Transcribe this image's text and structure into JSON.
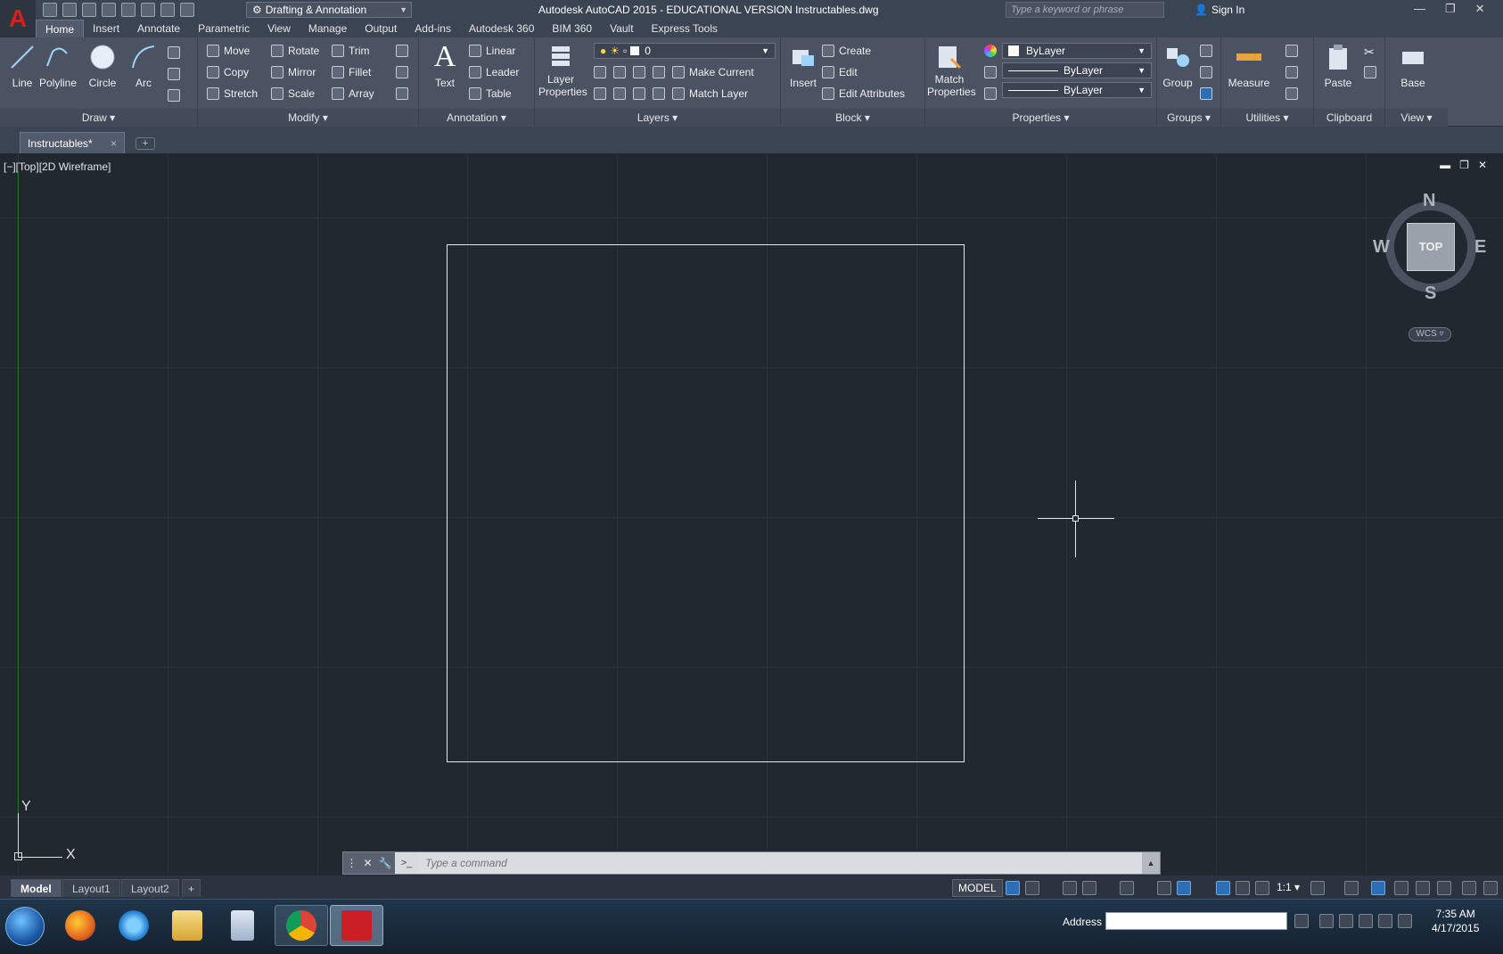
{
  "titlebar": {
    "app_title": "Autodesk AutoCAD 2015 - EDUCATIONAL VERSION    Instructables.dwg",
    "workspace": "Drafting & Annotation",
    "search_placeholder": "Type a keyword or phrase",
    "sign_in": "Sign In"
  },
  "tabs": [
    "Home",
    "Insert",
    "Annotate",
    "Parametric",
    "View",
    "Manage",
    "Output",
    "Add-ins",
    "Autodesk 360",
    "BIM 360",
    "Vault",
    "Express Tools"
  ],
  "ribbon": {
    "draw": {
      "footer": "Draw ▾",
      "line": "Line",
      "polyline": "Polyline",
      "circle": "Circle",
      "arc": "Arc"
    },
    "modify": {
      "footer": "Modify ▾",
      "move": "Move",
      "rotate": "Rotate",
      "trim": "Trim",
      "copy": "Copy",
      "mirror": "Mirror",
      "fillet": "Fillet",
      "stretch": "Stretch",
      "scale": "Scale",
      "array": "Array"
    },
    "annotation": {
      "footer": "Annotation ▾",
      "text": "Text",
      "linear": "Linear",
      "leader": "Leader",
      "table": "Table"
    },
    "layers": {
      "footer": "Layers ▾",
      "layer_properties_1": "Layer",
      "layer_properties_2": "Properties",
      "current_layer": "0",
      "make_current": "Make Current",
      "match_layer": "Match Layer"
    },
    "block": {
      "footer": "Block ▾",
      "insert": "Insert",
      "create": "Create",
      "edit": "Edit",
      "edit_attributes": "Edit Attributes"
    },
    "properties": {
      "footer": "Properties ▾",
      "match_1": "Match",
      "match_2": "Properties",
      "color": "ByLayer",
      "linetype": "ByLayer",
      "lineweight": "ByLayer"
    },
    "groups": {
      "footer": "Groups ▾",
      "group": "Group"
    },
    "utilities": {
      "footer": "Utilities ▾",
      "measure": "Measure"
    },
    "clipboard": {
      "footer": "Clipboard",
      "paste": "Paste"
    },
    "view": {
      "footer": "View ▾",
      "base": "Base"
    }
  },
  "doc_tab": {
    "name": "Instructables*",
    "close": "×",
    "new": "+"
  },
  "viewport": {
    "label": "[−][Top][2D Wireframe]",
    "viewcube_top": "TOP",
    "north": "N",
    "south": "S",
    "east": "E",
    "west": "W",
    "wcs": "WCS ▿",
    "ucs_y": "Y",
    "ucs_x": "X"
  },
  "command": {
    "placeholder": "Type a command"
  },
  "layout_tabs": [
    "Model",
    "Layout1",
    "Layout2"
  ],
  "status": {
    "model": "MODEL",
    "scale": "1:1 ▾"
  },
  "taskbar": {
    "address_label": "Address",
    "time": "7:35 AM",
    "date": "4/17/2015"
  },
  "colors": {
    "canvas_bg": "#212830",
    "ribbon_bg": "#4b5363",
    "accent_red": "#d6201e"
  }
}
